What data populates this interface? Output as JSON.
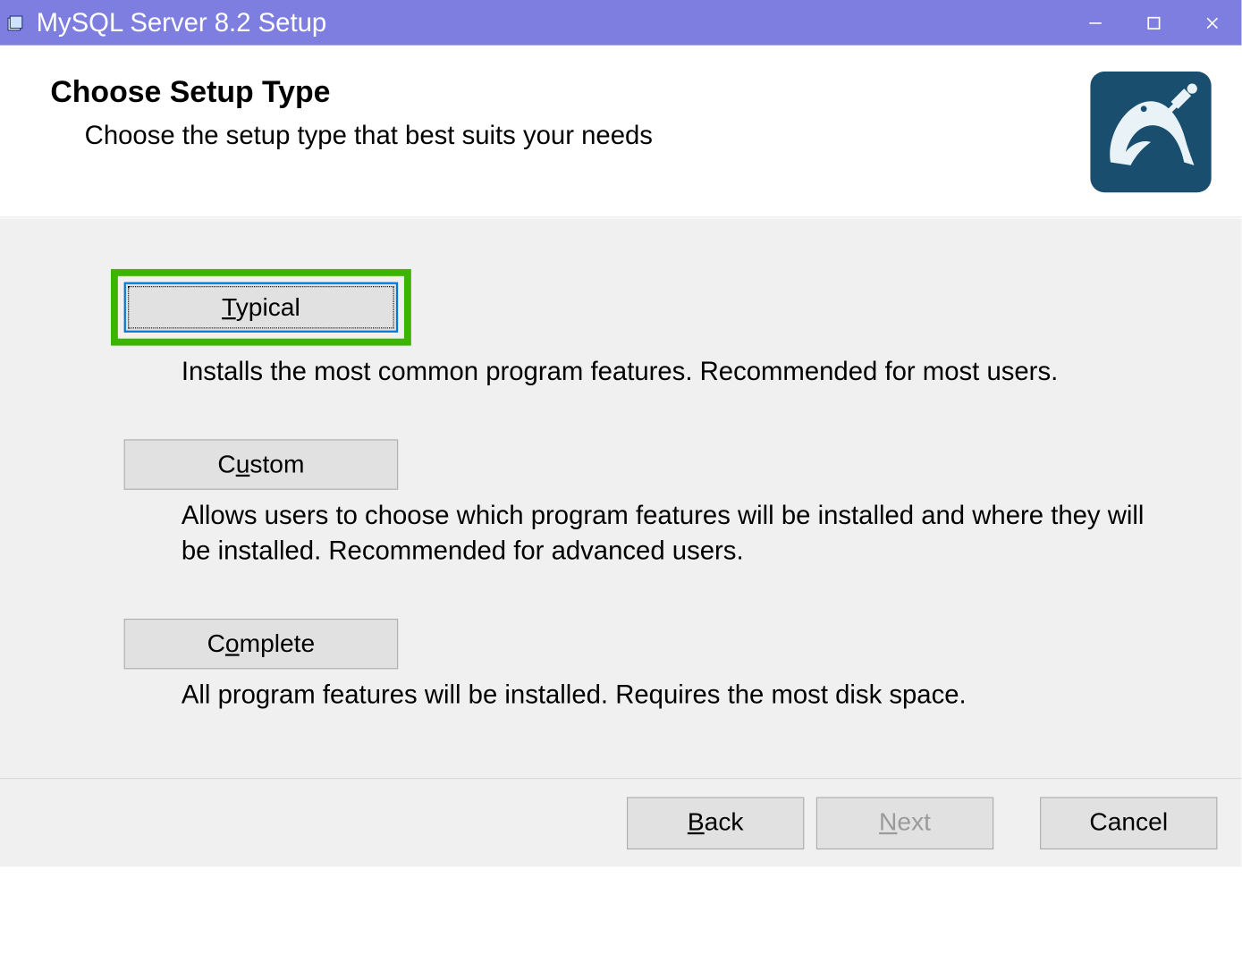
{
  "window": {
    "title": "MySQL Server 8.2 Setup"
  },
  "header": {
    "title": "Choose Setup Type",
    "subtitle": "Choose the setup type that best suits your needs"
  },
  "options": {
    "typical": {
      "label_pre": "T",
      "label_rest": "ypical",
      "desc": "Installs the most common program features. Recommended for most users."
    },
    "custom": {
      "label_pre": "C",
      "label_u": "u",
      "label_rest": "stom",
      "desc": "Allows users to choose which program features will be installed and where they will be installed. Recommended for advanced users."
    },
    "complete": {
      "label_pre": "C",
      "label_u": "o",
      "label_rest": "mplete",
      "desc": "All program features will be installed. Requires the most disk space."
    }
  },
  "footer": {
    "back_pre": "",
    "back_u": "B",
    "back_rest": "ack",
    "next_pre": "",
    "next_u": "N",
    "next_rest": "ext",
    "cancel": "Cancel"
  }
}
